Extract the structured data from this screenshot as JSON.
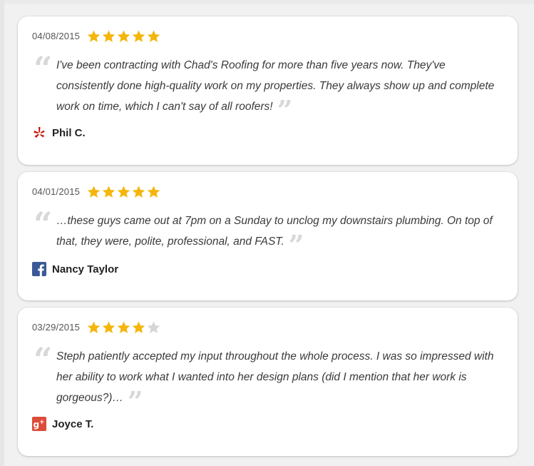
{
  "reviews": [
    {
      "date": "04/08/2015",
      "rating": 5,
      "text": "I've been contracting with Chad's Roofing for more than five years now. They've consistently done high-quality work on my properties. They always show up and complete work on time, which I can't say of all roofers!",
      "author": "Phil C.",
      "source_icon": "yelp-icon"
    },
    {
      "date": "04/01/2015",
      "rating": 5,
      "text": "…these guys came out at 7pm on a Sunday to unclog my downstairs plumbing. On top of that, they were, polite, professional, and FAST.",
      "author": "Nancy Taylor",
      "source_icon": "facebook-icon"
    },
    {
      "date": "03/29/2015",
      "rating": 4,
      "text": "Steph patiently accepted my input throughout the whole process. I was so impressed with her ability to work what I wanted into her design plans (did I mention that her work is gorgeous?)…",
      "author": "Joyce T.",
      "source_icon": "google-plus-icon"
    }
  ],
  "colors": {
    "star_filled": "#f5b50a",
    "star_empty": "#d5d5d5",
    "quote_mark": "#d8d8d8",
    "yelp": "#c41200",
    "facebook": "#3b5998",
    "google_plus": "#dd4b39"
  }
}
